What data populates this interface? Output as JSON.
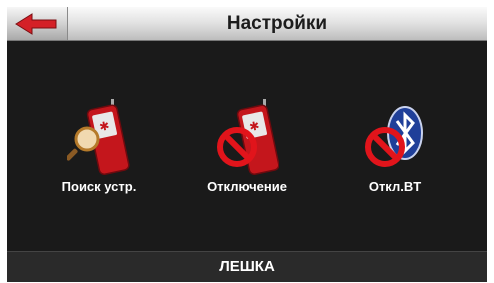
{
  "header": {
    "title": "Настройки",
    "back_icon": "red-left-arrow-icon"
  },
  "menu": {
    "items": [
      {
        "label": "Поиск устр.",
        "icon": "phone-search-icon"
      },
      {
        "label": "Отключение",
        "icon": "phone-disconnect-icon"
      },
      {
        "label": "Откл.BT",
        "icon": "bluetooth-off-icon"
      }
    ]
  },
  "footer": {
    "device_name": "ЛЕШКА"
  },
  "colors": {
    "accent": "#d42027",
    "background": "#1b1b1b"
  }
}
